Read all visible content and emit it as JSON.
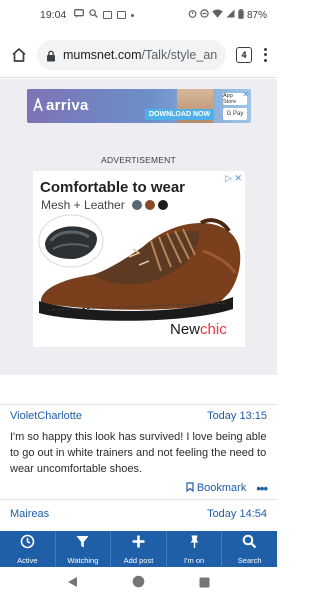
{
  "status_bar": {
    "time": "19:04",
    "battery": "87%"
  },
  "browser": {
    "url_host": "mumsnet.com",
    "url_path": "/Talk/style_an",
    "tab_count": "4"
  },
  "banner_ad": {
    "brand": "arriva",
    "cta": "DOWNLOAD NOW",
    "store_badge": "App Store",
    "pay_badge": "G Pay"
  },
  "ad_label": "ADVERTISEMENT",
  "shoe_ad": {
    "headline": "Comfortable to wear",
    "subline": "Mesh + Leather",
    "brand_a": "New",
    "brand_b": "chic",
    "swatches": [
      "#5b6770",
      "#8a4a2a",
      "#1c1c1c"
    ]
  },
  "comments": [
    {
      "author": "VioletCharlotte",
      "time": "Today 13:15",
      "body": "I'm so happy this look has survived! I love being able to go out in white trainers and not feeling the need to wear uncomfortable shoes.",
      "bookmark_label": "Bookmark"
    },
    {
      "author": "Maireas",
      "time": "Today 14:54"
    }
  ],
  "bottom_nav": [
    {
      "label": "Active",
      "icon": "clock-icon"
    },
    {
      "label": "Watching",
      "icon": "filter-icon"
    },
    {
      "label": "Add post",
      "icon": "plus-icon"
    },
    {
      "label": "I'm on",
      "icon": "pin-icon"
    },
    {
      "label": "Search",
      "icon": "search-icon"
    }
  ],
  "colors": {
    "brand_blue": "#1f5fa8",
    "ad_background": "#eeeef2"
  }
}
